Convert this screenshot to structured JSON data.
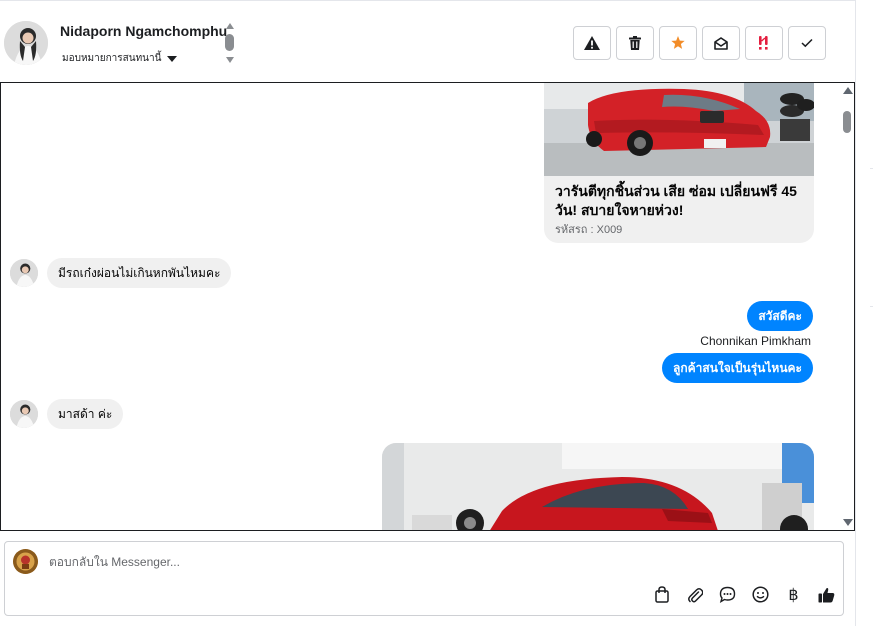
{
  "header": {
    "contact_name": "Nidaporn Ngamchomphu",
    "assign_label": "มอบหมายการสนทนานี้",
    "actions": [
      {
        "name": "report-spam-button",
        "icon": "warning-icon"
      },
      {
        "name": "delete-button",
        "icon": "trash-icon"
      },
      {
        "name": "star-button",
        "icon": "star-icon"
      },
      {
        "name": "mark-unread-button",
        "icon": "envelope-open-icon"
      },
      {
        "name": "follow-up-button",
        "icon": "follow-up-icon"
      },
      {
        "name": "mark-done-button",
        "icon": "check-icon"
      }
    ]
  },
  "chat": {
    "card": {
      "title": " วารันตีทุกชิ้นส่วน เสีย ซ่อม เปลี่ยนฟรี 45 วัน! สบายใจหายห่วง!",
      "code": "รหัสรถ : X009"
    },
    "messages": {
      "in_1": "มีรถเก๋งผ่อนไม่เกินหกพันไหมคะ",
      "out_1": "สวัสดีคะ",
      "sender": "Chonnikan Pimkham",
      "out_2": "ลูกค้าสนใจเป็นรุ่นไหนคะ",
      "in_2": "มาสด้า ค่ะ"
    }
  },
  "composer": {
    "placeholder": "ตอบกลับใน Messenger...",
    "tools": [
      "shopping-bag-icon",
      "paperclip-icon",
      "saved-reply-icon",
      "emoji-icon",
      "baht-icon",
      "thumbs-up-icon"
    ],
    "baht_glyph": "฿"
  },
  "colors": {
    "outgoing_bubble": "#0084ff",
    "incoming_bubble": "#f0f0f0",
    "star": "#f28c28",
    "follow_up": "#e41e3f"
  }
}
